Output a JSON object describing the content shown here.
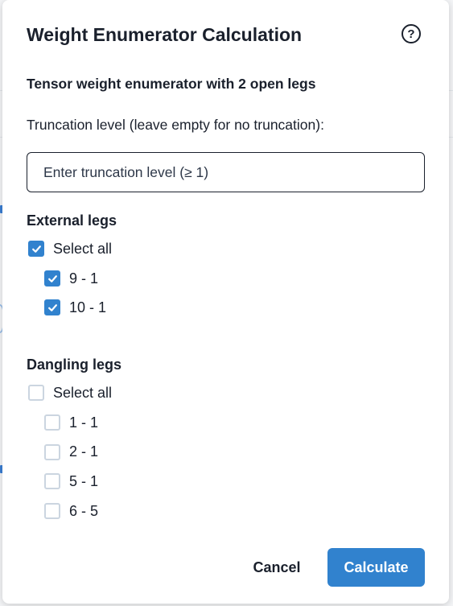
{
  "dialog": {
    "title": "Weight Enumerator Calculation",
    "help_glyph": "?",
    "help_icon": "question-circle-icon",
    "subtitle": "Tensor weight enumerator with 2 open legs",
    "truncation": {
      "label": "Truncation level (leave empty for no truncation):",
      "value": "",
      "placeholder": "Enter truncation level (≥ 1)"
    },
    "external_legs": {
      "title": "External legs",
      "select_all": {
        "label": "Select all",
        "checked": true
      },
      "items": [
        {
          "label": "9 - 1",
          "checked": true
        },
        {
          "label": "10 - 1",
          "checked": true
        }
      ]
    },
    "dangling_legs": {
      "title": "Dangling legs",
      "select_all": {
        "label": "Select all",
        "checked": false
      },
      "items": [
        {
          "label": "1 - 1",
          "checked": false
        },
        {
          "label": "2 - 1",
          "checked": false
        },
        {
          "label": "5 - 1",
          "checked": false
        },
        {
          "label": "6 - 5",
          "checked": false
        }
      ]
    },
    "buttons": {
      "cancel": "Cancel",
      "calculate": "Calculate"
    }
  },
  "colors": {
    "accent": "#3182ce",
    "text": "#1a202c",
    "unchecked_border": "#cbd5e0"
  }
}
